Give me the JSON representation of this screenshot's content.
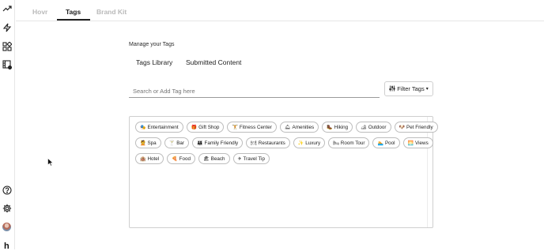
{
  "nav_tabs": [
    {
      "label": "Hovr"
    },
    {
      "label": "Tags"
    },
    {
      "label": "Brand Kit"
    }
  ],
  "brand": {
    "letter": "h"
  },
  "section_title": "Manage your Tags",
  "subtabs": [
    {
      "label": "Tags Library"
    },
    {
      "label": "Submitted Content"
    }
  ],
  "search": {
    "placeholder": "Search or Add Tag here",
    "value": ""
  },
  "filter": {
    "label": "Filter Tags",
    "caret": "▾"
  },
  "tags": [
    [
      {
        "emoji": "🎭",
        "label": "Entertainment"
      },
      {
        "emoji": "🎁",
        "label": "Gift Shop"
      },
      {
        "emoji": "🏋",
        "label": "Fitness Center"
      },
      {
        "emoji": "🛎",
        "label": "Amenities"
      },
      {
        "emoji": "🥾",
        "label": "Hiking"
      },
      {
        "emoji": "🏕",
        "label": "Outdoor"
      },
      {
        "emoji": "🐶",
        "label": "Pet Friendly"
      }
    ],
    [
      {
        "emoji": "💆",
        "label": "Spa"
      },
      {
        "emoji": "🍸",
        "label": "Bar"
      },
      {
        "emoji": "👨‍👩‍👧",
        "label": "Family Friendly"
      },
      {
        "emoji": "🍽",
        "label": "Restaurants"
      },
      {
        "emoji": "✨",
        "label": "Luxury"
      },
      {
        "emoji": "🛏",
        "label": "Room Tour"
      },
      {
        "emoji": "🏊",
        "label": "Pool"
      },
      {
        "emoji": "🌅",
        "label": "Views"
      }
    ],
    [
      {
        "emoji": "🏨",
        "label": "Hotel"
      },
      {
        "emoji": "🍕",
        "label": "Food"
      },
      {
        "emoji": "🏖",
        "label": "Beach"
      },
      {
        "emoji": "✈",
        "label": "Travel Tip"
      }
    ]
  ]
}
